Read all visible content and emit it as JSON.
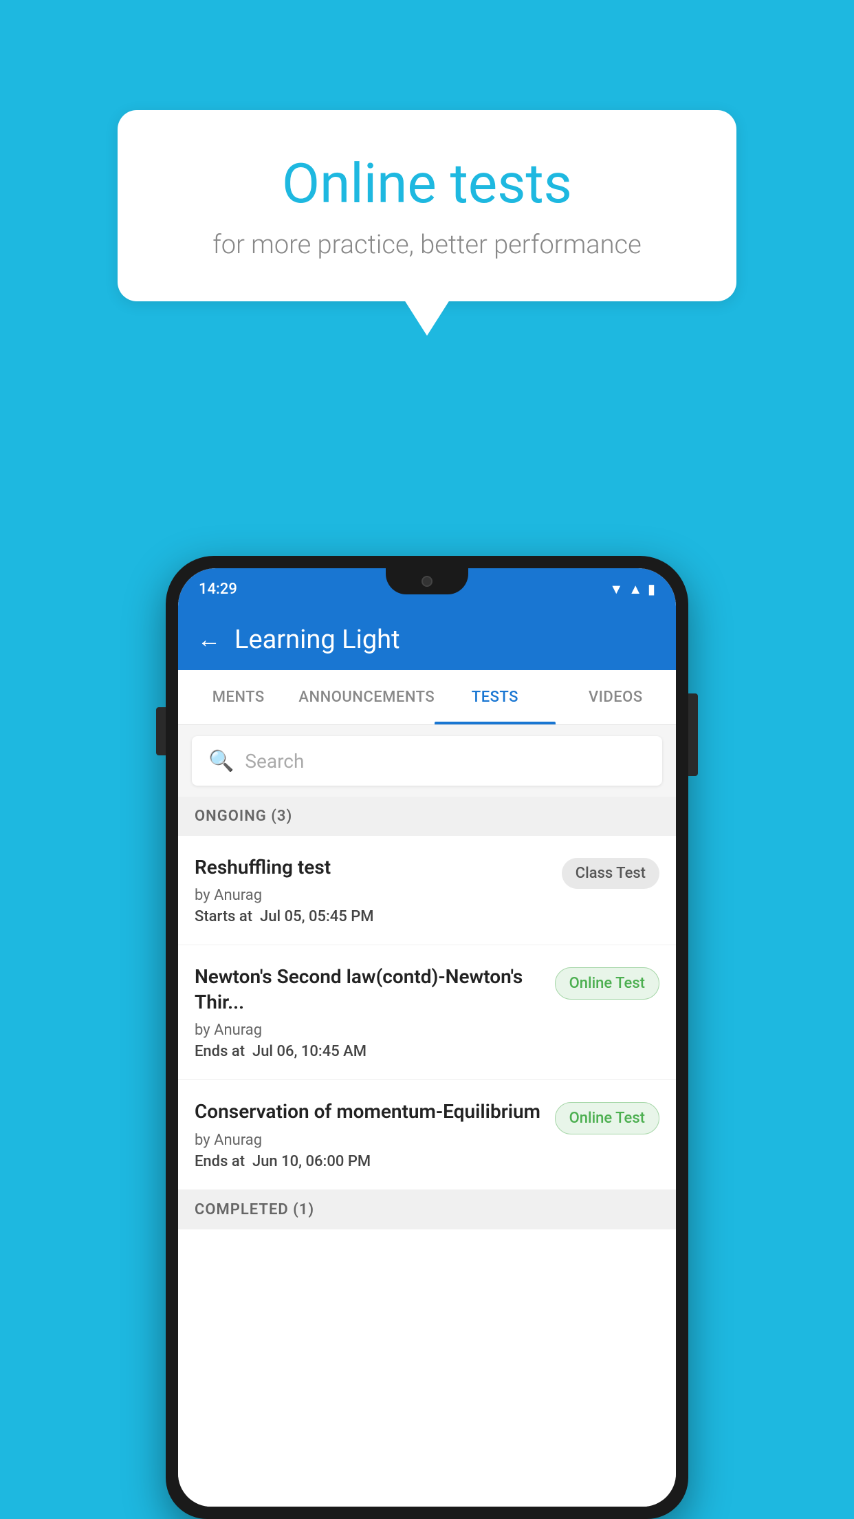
{
  "background_color": "#1eb8e0",
  "speech_bubble": {
    "title": "Online tests",
    "subtitle": "for more practice, better performance"
  },
  "phone": {
    "status_bar": {
      "time": "14:29",
      "icons": [
        "wifi",
        "signal",
        "battery"
      ]
    },
    "app_bar": {
      "title": "Learning Light",
      "back_label": "←"
    },
    "tabs": [
      {
        "label": "MENTS",
        "active": false
      },
      {
        "label": "ANNOUNCEMENTS",
        "active": false
      },
      {
        "label": "TESTS",
        "active": true
      },
      {
        "label": "VIDEOS",
        "active": false
      }
    ],
    "search": {
      "placeholder": "Search"
    },
    "ongoing_section": {
      "label": "ONGOING (3)"
    },
    "tests": [
      {
        "name": "Reshuffling test",
        "by": "by Anurag",
        "date_label": "Starts at",
        "date": "Jul 05, 05:45 PM",
        "badge": "Class Test",
        "badge_type": "class"
      },
      {
        "name": "Newton's Second law(contd)-Newton's Thir...",
        "by": "by Anurag",
        "date_label": "Ends at",
        "date": "Jul 06, 10:45 AM",
        "badge": "Online Test",
        "badge_type": "online"
      },
      {
        "name": "Conservation of momentum-Equilibrium",
        "by": "by Anurag",
        "date_label": "Ends at",
        "date": "Jun 10, 06:00 PM",
        "badge": "Online Test",
        "badge_type": "online"
      }
    ],
    "completed_section": {
      "label": "COMPLETED (1)"
    }
  }
}
